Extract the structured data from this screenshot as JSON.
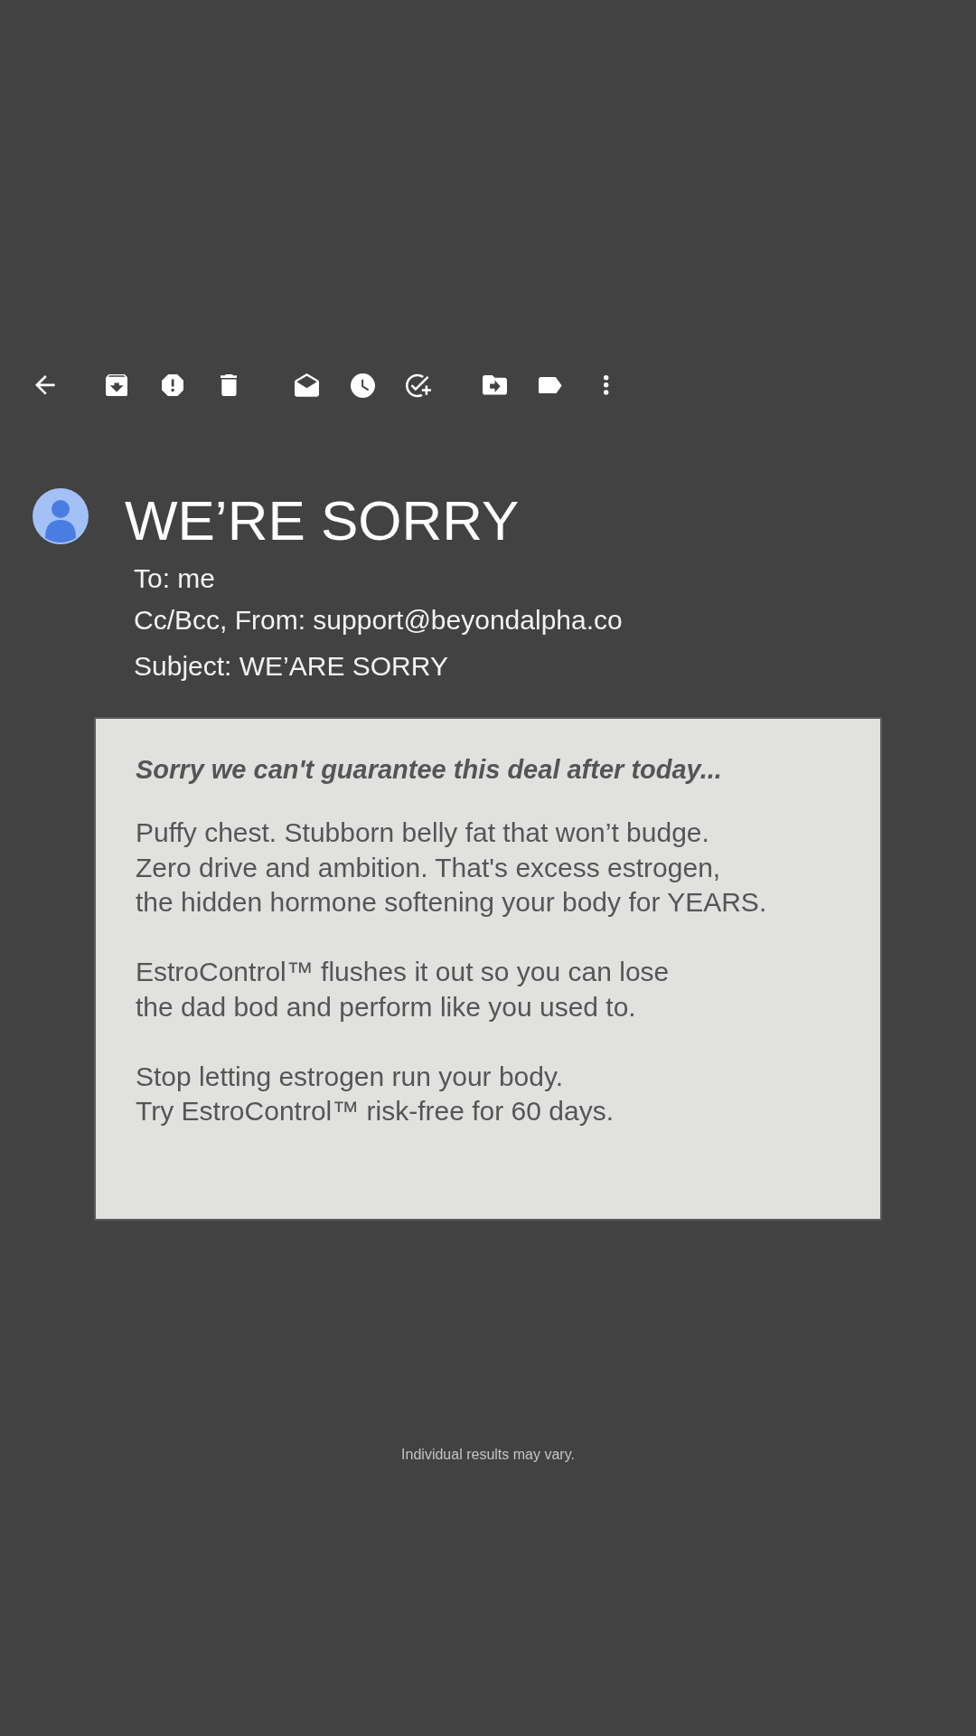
{
  "email": {
    "title": "WE’RE SORRY",
    "to": "To: me",
    "from": "Cc/Bcc, From: support@beyondalpha.co",
    "subject": "Subject: WE’ARE SORRY"
  },
  "message": {
    "headline": "Sorry we can't guarantee this deal after today...",
    "paragraphs": [
      {
        "lines": [
          "Puffy chest. Stubborn belly fat that won’t budge.",
          "Zero drive and ambition. That's excess estrogen,",
          "the hidden hormone softening your body for YEARS."
        ]
      },
      {
        "lines": [
          "EstroControl™ flushes it out so you can lose",
          "the dad bod and perform like you used to."
        ]
      },
      {
        "lines": [
          "Stop letting estrogen run your body.",
          "Try EstroControl™ risk-free for 60 days."
        ]
      }
    ]
  },
  "footer": {
    "disclaimer": "Individual results may vary."
  }
}
